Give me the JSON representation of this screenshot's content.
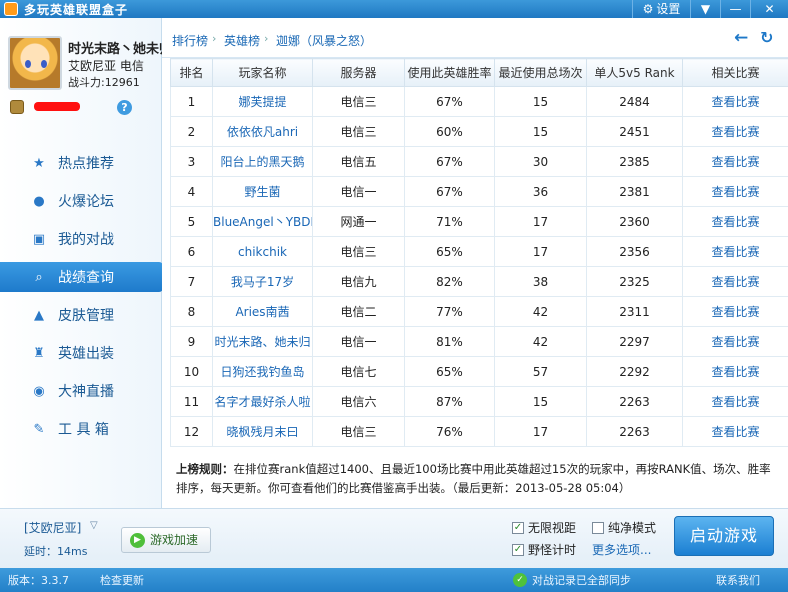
{
  "titlebar": {
    "title": "多玩英雄联盟盒子",
    "settings_label": "设置",
    "menu_icon": "▼",
    "min_icon": "—",
    "close_icon": "✕"
  },
  "user": {
    "name": "时光末路丶她未归",
    "server": "艾欧尼亚  电信",
    "power": "战斗力:12961"
  },
  "nav": [
    {
      "label": "热点推荐",
      "icon": "★"
    },
    {
      "label": "火爆论坛",
      "icon": "●"
    },
    {
      "label": "我的对战",
      "icon": "▣"
    },
    {
      "label": "战绩查询",
      "icon": "⌕"
    },
    {
      "label": "皮肤管理",
      "icon": "▲"
    },
    {
      "label": "英雄出装",
      "icon": "♜"
    },
    {
      "label": "大神直播",
      "icon": "◉"
    },
    {
      "label": "工 具 箱",
      "icon": "✎"
    }
  ],
  "breadcrumb": {
    "level1": "排行榜",
    "level2": "英雄榜",
    "level3": "迦娜（风暴之怒）"
  },
  "table": {
    "headers": [
      "排名",
      "玩家名称",
      "服务器",
      "使用此英雄胜率",
      "最近使用总场次",
      "单人5v5 Rank",
      "相关比赛"
    ],
    "rows": [
      [
        "1",
        "娜芙提提",
        "电信三",
        "67%",
        "15",
        "2484",
        "查看比赛"
      ],
      [
        "2",
        "依依依凡ahri",
        "电信三",
        "60%",
        "15",
        "2451",
        "查看比赛"
      ],
      [
        "3",
        "阳台上的黑天鹅",
        "电信五",
        "67%",
        "30",
        "2385",
        "查看比赛"
      ],
      [
        "4",
        "野生菌",
        "电信一",
        "67%",
        "36",
        "2381",
        "查看比赛"
      ],
      [
        "5",
        "BlueAngel丶YBDL",
        "网通一",
        "71%",
        "17",
        "2360",
        "查看比赛"
      ],
      [
        "6",
        "chikchik",
        "电信三",
        "65%",
        "17",
        "2356",
        "查看比赛"
      ],
      [
        "7",
        "我马子17岁",
        "电信九",
        "82%",
        "38",
        "2325",
        "查看比赛"
      ],
      [
        "8",
        "Aries南茜",
        "电信二",
        "77%",
        "42",
        "2311",
        "查看比赛"
      ],
      [
        "9",
        "时光末路、她未归",
        "电信一",
        "81%",
        "42",
        "2297",
        "查看比赛"
      ],
      [
        "10",
        "日狗还我钓鱼岛",
        "电信七",
        "65%",
        "57",
        "2292",
        "查看比赛"
      ],
      [
        "11",
        "名字才最好杀人啦",
        "电信六",
        "87%",
        "15",
        "2263",
        "查看比赛"
      ],
      [
        "12",
        "晓枫残月末曰",
        "电信三",
        "76%",
        "17",
        "2263",
        "查看比赛"
      ]
    ]
  },
  "rules": {
    "title": "上榜规则：",
    "text": "在排位赛rank值超过1400、且最近100场比赛中用此英雄超过15次的玩家中，再按RANK值、场次、胜率排序，每天更新。你可查看他们的比赛借鉴高手出装。（最后更新：2013-05-28 05:04）"
  },
  "bottom": {
    "server_select": "[艾欧尼亚]",
    "latency": "延时：14ms",
    "accel_label": "游戏加速",
    "options": [
      {
        "label": "无限视距",
        "checked": true
      },
      {
        "label": "纯净模式",
        "checked": false
      },
      {
        "label": "野怪计时",
        "checked": true
      }
    ],
    "more_options": "更多选项...",
    "launch_label": "启动游戏"
  },
  "statusbar": {
    "version": "版本：3.3.7",
    "check_update": "检查更新",
    "sync_status": "对战记录已全部同步",
    "contact": "联系我们"
  }
}
